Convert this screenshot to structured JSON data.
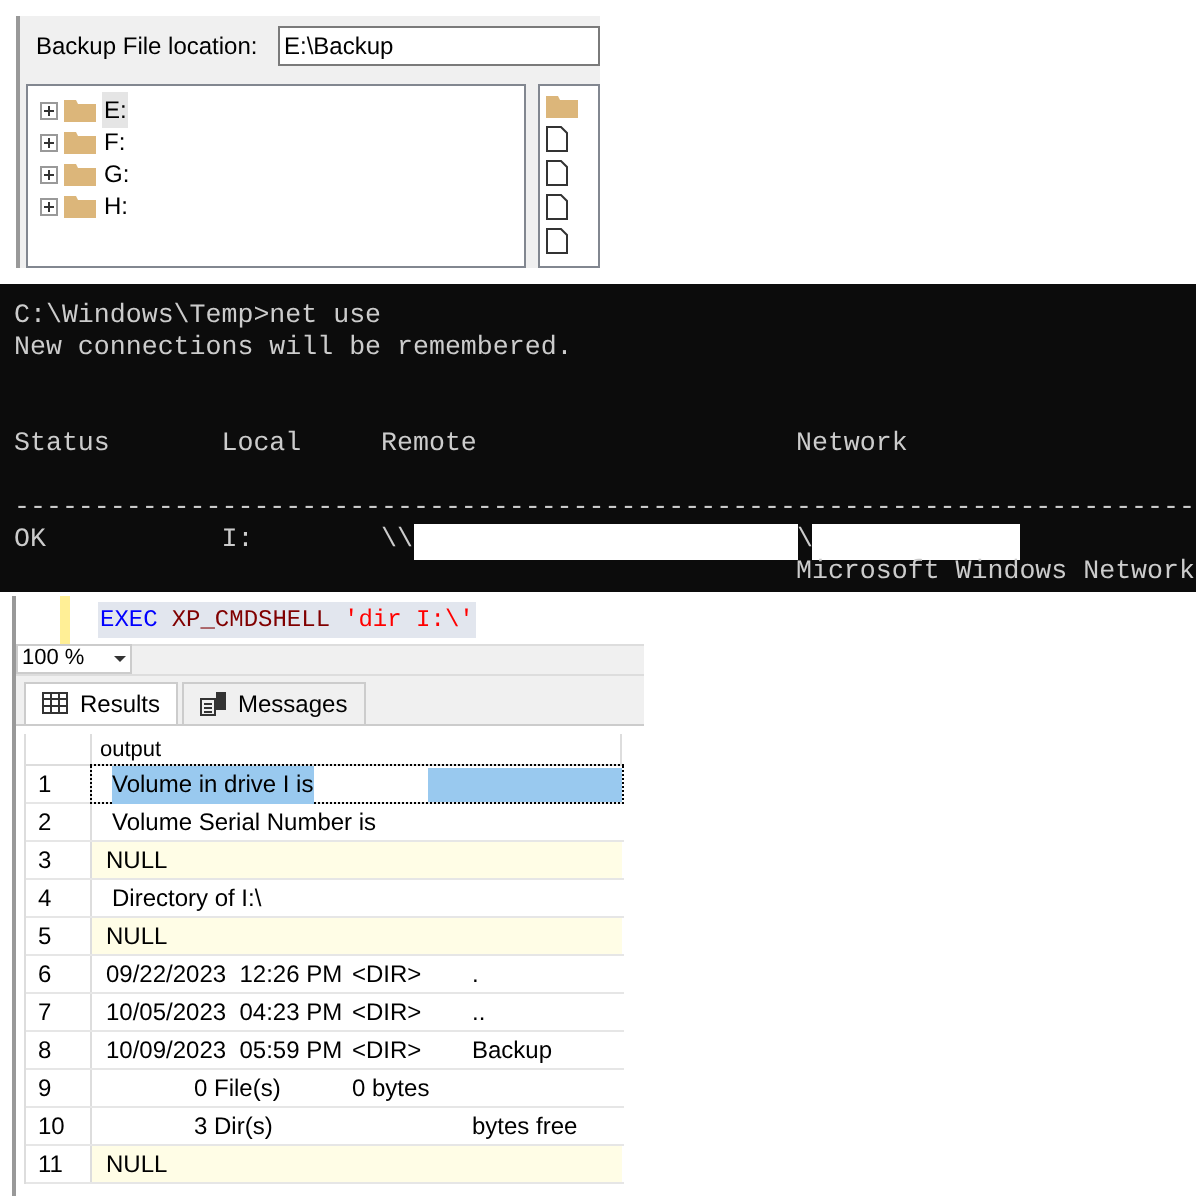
{
  "backup_dialog": {
    "label": "Backup File location:",
    "value": "E:\\Backup",
    "drives": [
      {
        "label": "E:",
        "selected": true
      },
      {
        "label": "F:",
        "selected": false
      },
      {
        "label": "G:",
        "selected": false
      },
      {
        "label": "H:",
        "selected": false
      }
    ],
    "files": [
      {
        "kind": "folder"
      },
      {
        "kind": "file"
      },
      {
        "kind": "file"
      },
      {
        "kind": "file"
      },
      {
        "kind": "file"
      }
    ]
  },
  "console": {
    "lines": [
      {
        "kind": "text",
        "segments": [
          {
            "kind": "text",
            "text": "C:\\Windows\\Temp>net use"
          }
        ]
      },
      {
        "kind": "text",
        "segments": [
          {
            "kind": "text",
            "text": "New connections will be remembered."
          }
        ]
      },
      {
        "kind": "blank"
      },
      {
        "kind": "blank"
      },
      {
        "kind": "text",
        "segments": [
          {
            "kind": "text",
            "text": "Status       Local     Remote                    Network"
          }
        ]
      },
      {
        "kind": "blank"
      },
      {
        "kind": "text",
        "segments": [
          {
            "kind": "text",
            "text": "--------------------------------------------------------------------------"
          }
        ]
      },
      {
        "kind": "text",
        "segments": [
          {
            "kind": "text",
            "text": "OK           I:        \\\\"
          },
          {
            "kind": "redacted_host"
          },
          {
            "kind": "text",
            "text": "\\"
          },
          {
            "kind": "redacted_share"
          }
        ]
      },
      {
        "kind": "text",
        "segments": [
          {
            "kind": "text",
            "text": "                                                 Microsoft Windows Network"
          }
        ]
      }
    ]
  },
  "query": {
    "tokens": [
      {
        "kind": "keyword",
        "text": "EXEC"
      },
      {
        "kind": "proc",
        "text": "XP_CMDSHELL"
      },
      {
        "kind": "string",
        "text": "'dir I:\\'"
      }
    ],
    "zoom": "100 %",
    "tabs": [
      {
        "label": "Results",
        "kind": "grid",
        "selected": true
      },
      {
        "label": "Messages",
        "kind": "messages",
        "selected": false
      }
    ],
    "column": "output",
    "rows": [
      {
        "number": "1",
        "selected": true,
        "null": false,
        "parts": [
          {
            "kind": "name_line",
            "text": "Volume in drive I is"
          }
        ]
      },
      {
        "number": "2",
        "selected": false,
        "null": false,
        "parts": [
          {
            "kind": "name_line",
            "text": "Volume Serial Number is"
          }
        ]
      },
      {
        "number": "3",
        "selected": false,
        "null": true,
        "parts": [
          {
            "kind": "date",
            "text": "NULL"
          }
        ]
      },
      {
        "number": "4",
        "selected": false,
        "null": false,
        "parts": [
          {
            "kind": "name_line",
            "text": "Directory of I:\\"
          }
        ]
      },
      {
        "number": "5",
        "selected": false,
        "null": true,
        "parts": [
          {
            "kind": "date",
            "text": "NULL"
          }
        ]
      },
      {
        "number": "6",
        "selected": false,
        "null": false,
        "parts": [
          {
            "kind": "date",
            "text": "09/22/2023  12:26 PM"
          },
          {
            "kind": "size",
            "text": "<DIR>"
          },
          {
            "kind": "name",
            "text": "."
          }
        ]
      },
      {
        "number": "7",
        "selected": false,
        "null": false,
        "parts": [
          {
            "kind": "date",
            "text": "10/05/2023  04:23 PM"
          },
          {
            "kind": "size",
            "text": "<DIR>"
          },
          {
            "kind": "name",
            "text": ".."
          }
        ]
      },
      {
        "number": "8",
        "selected": false,
        "null": false,
        "parts": [
          {
            "kind": "date",
            "text": "10/09/2023  05:59 PM"
          },
          {
            "kind": "size",
            "text": "<DIR>"
          },
          {
            "kind": "name",
            "text": "Backup"
          }
        ]
      },
      {
        "number": "9",
        "selected": false,
        "null": false,
        "parts": [
          {
            "kind": "count",
            "text": "0 File(s)"
          },
          {
            "kind": "size",
            "text": "0 bytes"
          }
        ]
      },
      {
        "number": "10",
        "selected": false,
        "null": false,
        "parts": [
          {
            "kind": "count",
            "text": "3 Dir(s)"
          },
          {
            "kind": "name",
            "text": "bytes free"
          }
        ]
      },
      {
        "number": "11",
        "selected": false,
        "null": true,
        "parts": [
          {
            "kind": "date",
            "text": "NULL"
          }
        ]
      }
    ]
  }
}
